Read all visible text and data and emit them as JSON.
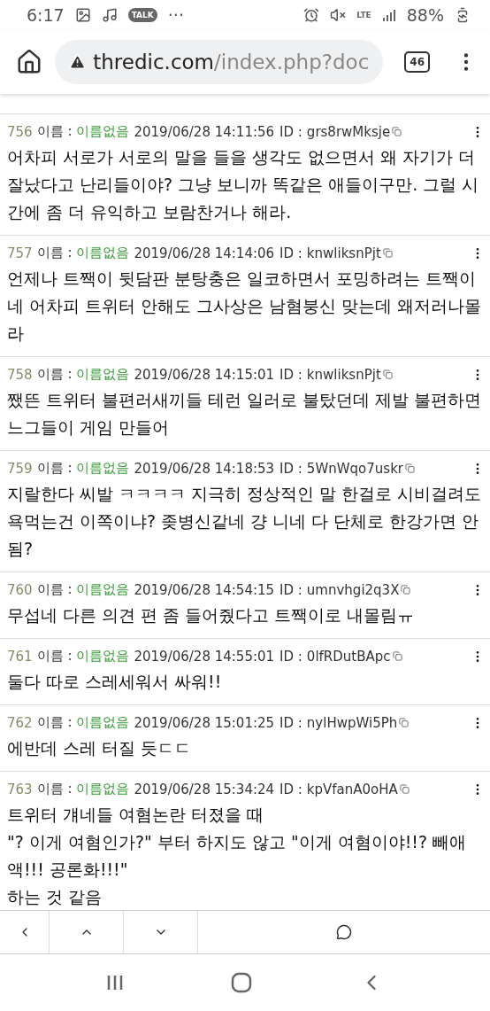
{
  "status_bar": {
    "time": "6:17",
    "talk_badge": "TALK",
    "more": "···",
    "network": "LTE",
    "battery": "88%"
  },
  "address_bar": {
    "domain": "thredic.com",
    "path": "/index.php?doc",
    "tab_count": "46"
  },
  "posts": [
    {
      "number": "756",
      "name_label": "이름 :",
      "name": "이름없음",
      "date": "2019/06/28 14:11:56",
      "id_label": "ID :",
      "id": "grs8rwMksje",
      "body": "어차피 서로가 서로의 말을 들을 생각도 없으면서 왜 자기가 더 잘났다고 난리들이야? 그냥 보니까 똑같은 애들이구만. 그럴 시간에 좀 더 유익하고 보람찬거나 해라."
    },
    {
      "number": "757",
      "name_label": "이름 :",
      "name": "이름없음",
      "date": "2019/06/28 14:14:06",
      "id_label": "ID :",
      "id": "knwliksnPjt",
      "body": "언제나 트짹이 뒷담판 분탕충은 일코하면서 포밍하려는 트짹이네 어차피 트위터 안해도 그사상은 남혐붕신 맞는데 왜저러나몰라"
    },
    {
      "number": "758",
      "name_label": "이름 :",
      "name": "이름없음",
      "date": "2019/06/28 14:15:01",
      "id_label": "ID :",
      "id": "knwliksnPjt",
      "body": "쨌뜬 트위터 불편러새끼들 테런 일러로 불탔던데 제발 불편하면 느그들이 게임 만들어"
    },
    {
      "number": "759",
      "name_label": "이름 :",
      "name": "이름없음",
      "date": "2019/06/28 14:18:53",
      "id_label": "ID :",
      "id": "5WnWqo7uskr",
      "body": "지랄한다 씨발 ㅋㅋㅋㅋ 지극히 정상적인 말 한걸로 시비걸려도 욕먹는건 이쪽이냐? 좆병신같네 걍 니네 다 단체로 한강가면 안됨?"
    },
    {
      "number": "760",
      "name_label": "이름 :",
      "name": "이름없음",
      "date": "2019/06/28 14:54:15",
      "id_label": "ID :",
      "id": "umnvhgi2q3X",
      "body": "무섭네 다른 의견 편 좀 들어줬다고 트짹이로 내몰림ㅠ"
    },
    {
      "number": "761",
      "name_label": "이름 :",
      "name": "이름없음",
      "date": "2019/06/28 14:55:01",
      "id_label": "ID :",
      "id": "0lfRDutBApc",
      "body": "둘다 따로 스레세워서 싸워!!"
    },
    {
      "number": "762",
      "name_label": "이름 :",
      "name": "이름없음",
      "date": "2019/06/28 15:01:25",
      "id_label": "ID :",
      "id": "nylHwpWi5Ph",
      "body": "에반데 스레 터질 듯ㄷㄷ"
    },
    {
      "number": "763",
      "name_label": "이름 :",
      "name": "이름없음",
      "date": "2019/06/28 15:34:24",
      "id_label": "ID :",
      "id": "kpVfanA0oHA",
      "body": "트위터 걔네들 여혐논란 터졌을 때\n\"? 이게 여혐인가?\" 부터 하지도 않고 \"이게 여혐이야!!? 빼애액!!! 공론화!!!\"\n하는 것 같음"
    }
  ],
  "bottom_toolbar": [
    {
      "kind": "prev"
    },
    {
      "kind": "up"
    },
    {
      "kind": "down"
    },
    {
      "kind": "comment"
    }
  ],
  "nav_bar": [
    {
      "kind": "recents"
    },
    {
      "kind": "home"
    },
    {
      "kind": "back"
    }
  ]
}
